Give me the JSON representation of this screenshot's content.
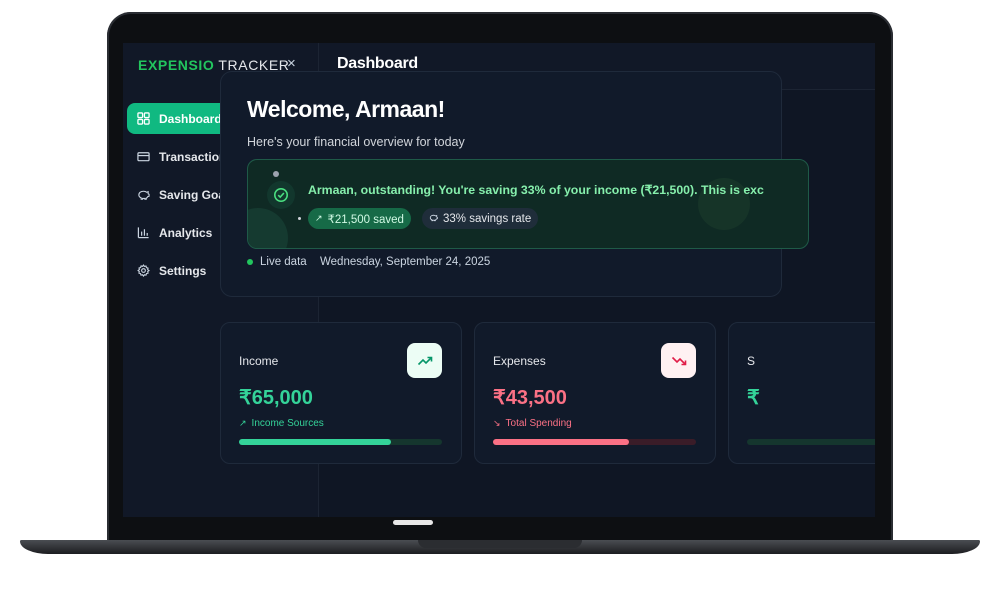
{
  "sidebar": {
    "brand_primary": "EXPENSIO",
    "brand_secondary": "TRACKER",
    "close_symbol": "×",
    "items": [
      {
        "label": "Dashboard",
        "icon": "grid-icon",
        "active": true
      },
      {
        "label": "Transactions",
        "icon": "credit-card-icon",
        "active": false
      },
      {
        "label": "Saving Goals",
        "icon": "piggy-bank-icon",
        "active": false
      },
      {
        "label": "Analytics",
        "icon": "bar-chart-icon",
        "active": false
      },
      {
        "label": "Settings",
        "icon": "gear-icon",
        "active": false
      }
    ]
  },
  "header": {
    "title": "Dashboard"
  },
  "welcome": {
    "title": "Welcome, Armaan!",
    "subtitle": "Here's your financial overview for today",
    "insight_message": "Armaan, outstanding! You're saving 33% of your income (₹21,500). This is exc",
    "saved_pill": "₹21,500 saved",
    "rate_pill": "33% savings rate",
    "live_label": "Live data",
    "date": "Wednesday, September 24, 2025"
  },
  "cards": {
    "income": {
      "label": "Income",
      "amount": "₹65,000",
      "sub_label": "Income Sources",
      "progress": 0.75
    },
    "expenses": {
      "label": "Expenses",
      "amount": "₹43,500",
      "sub_label": "Total Spending",
      "progress": 0.67
    },
    "savings": {
      "label": "S",
      "amount": "₹"
    }
  },
  "colors": {
    "accent_green": "#10b981",
    "income_green": "#34d399",
    "expense_red": "#fb7185",
    "background": "#0f1624"
  }
}
